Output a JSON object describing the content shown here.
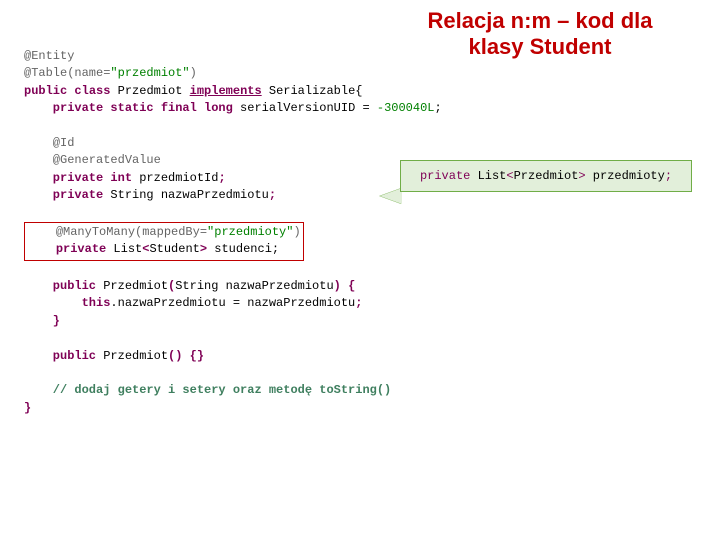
{
  "title_line1": "Relacja n:m – kod dla",
  "title_line2": "klasy Student",
  "callout": {
    "kw": "private",
    "rest": " List",
    "lt": "<",
    "type": "Przedmiot",
    "gt": ">",
    "var": " przedmioty",
    "semi": ";"
  },
  "code": {
    "l1a": "@Entity",
    "l2a": "@Table(name=",
    "l2b": "\"przedmiot\"",
    "l2c": ")",
    "l3a": "public",
    "l3b": " class",
    "l3c": " Przedmiot ",
    "l3d": "implements",
    "l3e": " Serializable{",
    "l4a": "    private static final long",
    "l4b": " serialVersionUID = ",
    "l4c": "-300040L",
    "l4d": ";",
    "l5": "",
    "l6": "    @Id",
    "l7": "    @GeneratedValue",
    "l8a": "    private int",
    "l8b": " przedmiotId",
    "l8c": ";",
    "l9a": "    private",
    "l9b": " String nazwaPrzedmiotu",
    "l9c": ";",
    "l10": "",
    "box1a": "@ManyToMany(mappedBy=",
    "box1b": "\"przedmioty\"",
    "box1c": ")",
    "box2a": "private",
    "box2b": " List",
    "box2lt": "<",
    "box2c": "Student",
    "box2gt": ">",
    "box2d": " studenci;",
    "l13": "",
    "l14a": "    public",
    "l14b": " Przedmiot",
    "l14c": "(",
    "l14d": "String nazwaPrzedmiotu",
    "l14e": ") {",
    "l15a": "        this",
    "l15b": ".nazwaPrzedmiotu = nazwaPrzedmiotu",
    "l15c": ";",
    "l16": "    }",
    "l17": "",
    "l18a": "    public",
    "l18b": " Przedmiot",
    "l18c": "() {}",
    "l19": "",
    "l20": "    // dodaj getery i setery oraz metodę toString()",
    "l21": "}"
  }
}
